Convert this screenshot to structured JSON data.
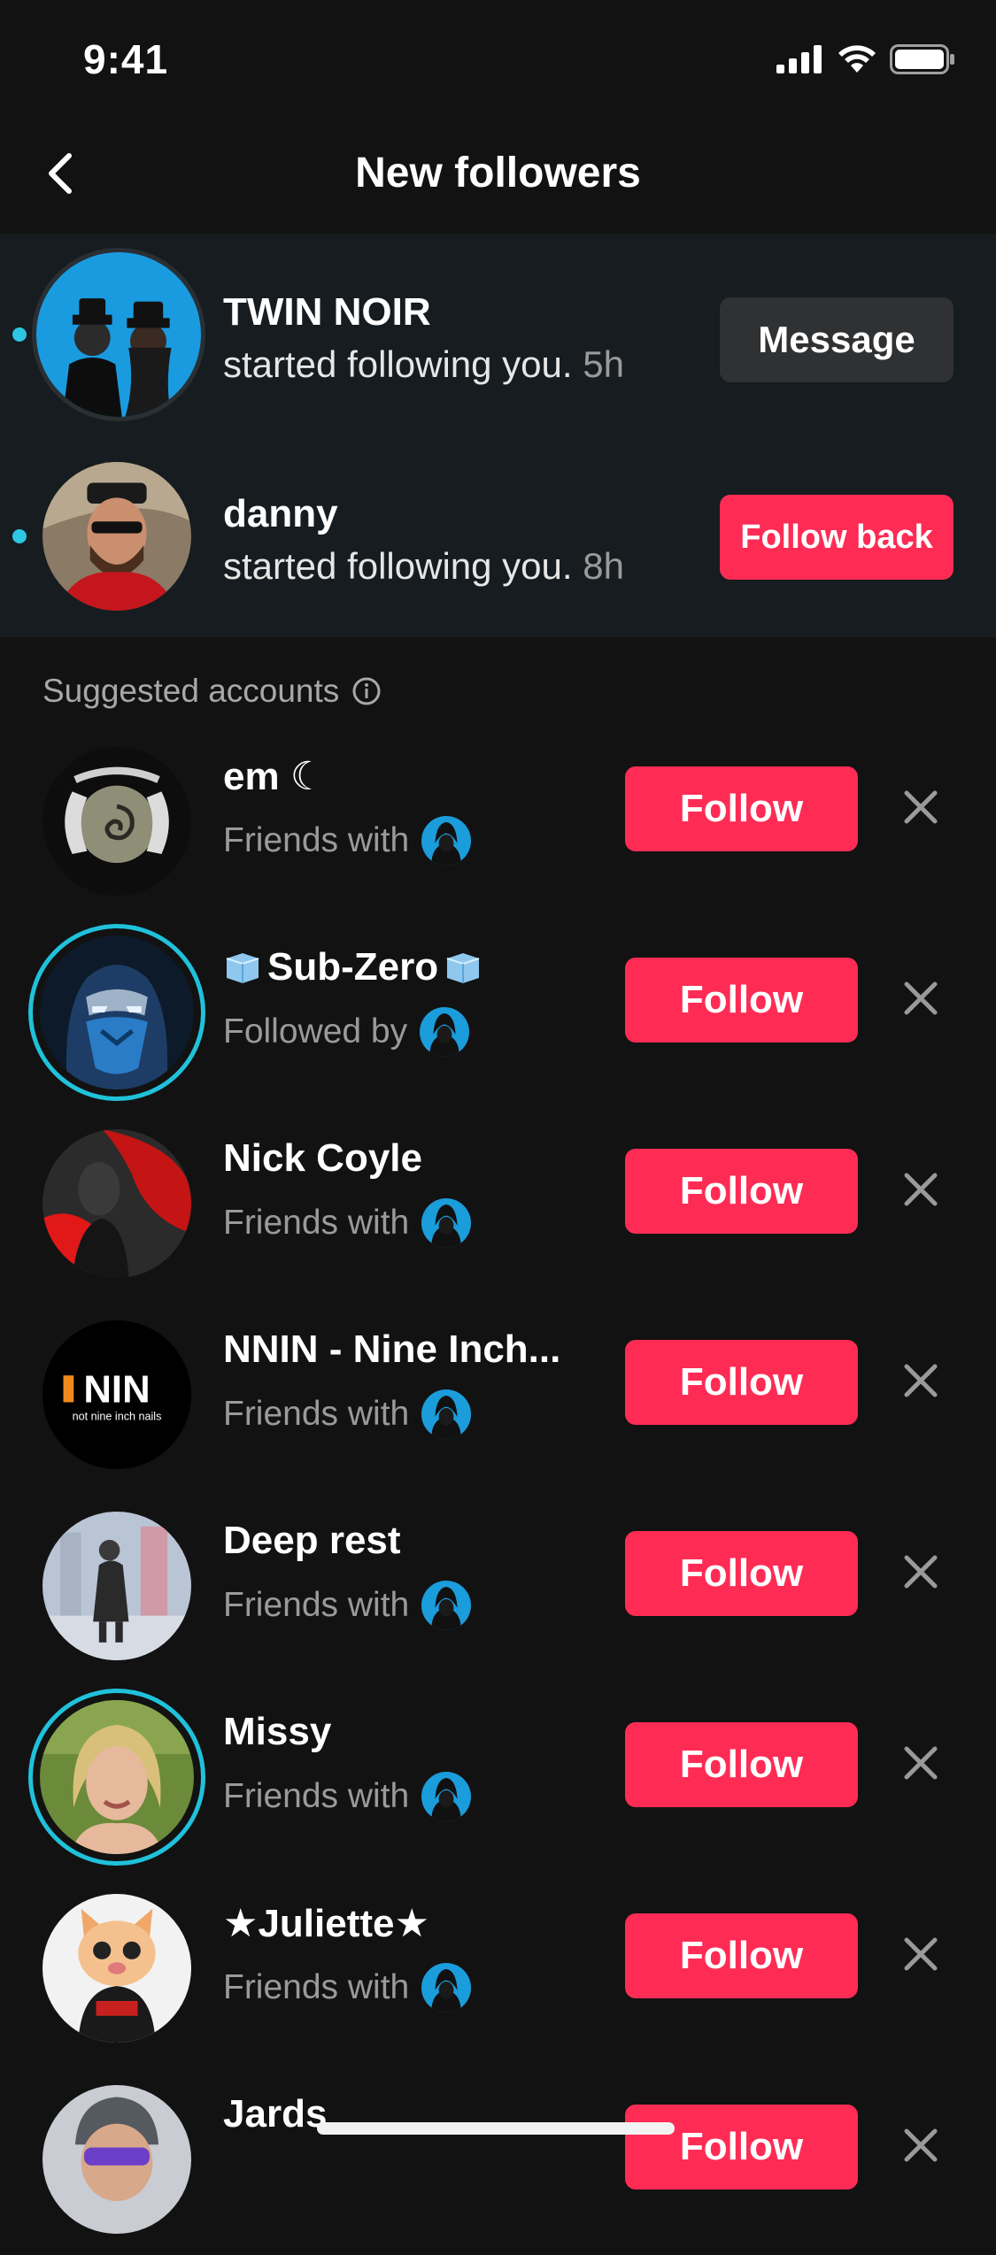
{
  "status_bar": {
    "time": "9:41"
  },
  "header": {
    "title": "New followers"
  },
  "notifications": [
    {
      "name": "TWIN NOIR",
      "text": "started following you.",
      "ago": "5h",
      "button": "Message"
    },
    {
      "name": "danny",
      "text": "started following you.",
      "ago": "8h",
      "button": "Follow back"
    }
  ],
  "suggested": {
    "header": "Suggested accounts",
    "items": [
      {
        "name": "em ☾",
        "meta": "Friends with",
        "button": "Follow"
      },
      {
        "name": "Sub-Zero",
        "meta": "Followed by",
        "button": "Follow"
      },
      {
        "name": "Nick Coyle",
        "meta": "Friends with",
        "button": "Follow"
      },
      {
        "name": "NNIN - Nine Inch...",
        "meta": "Friends with",
        "button": "Follow"
      },
      {
        "name": "Deep rest",
        "meta": "Friends with",
        "button": "Follow"
      },
      {
        "name": "Missy",
        "meta": "Friends with",
        "button": "Follow"
      },
      {
        "name": "★Juliette★",
        "meta": "Friends with",
        "button": "Follow"
      },
      {
        "name": "Jards",
        "button": "Follow"
      }
    ]
  },
  "logo_text": {
    "nin_main": "NIN",
    "nin_sub": "not nine inch nails"
  },
  "colors": {
    "accent": "#fe2c55",
    "unread": "#2dc6e3",
    "background": "#121212"
  }
}
